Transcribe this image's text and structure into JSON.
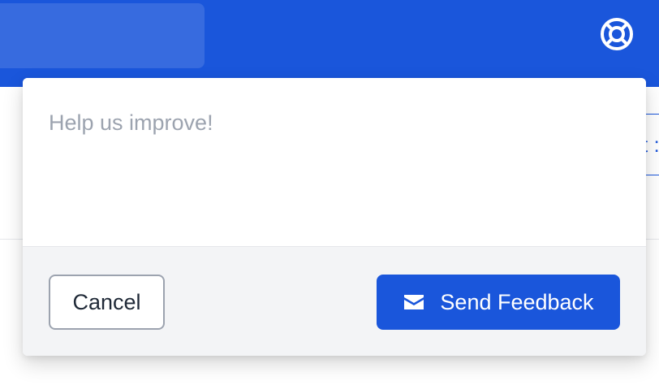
{
  "colors": {
    "brand": "#1a56db",
    "footer_bg": "#f3f4f6",
    "placeholder": "#9ca3af"
  },
  "topbar": {
    "help_icon": "lifebuoy-icon"
  },
  "background": {
    "partial_button_text": "t :"
  },
  "feedback": {
    "input_value": "",
    "placeholder": "Help us improve!",
    "cancel_label": "Cancel",
    "send_label": "Send Feedback",
    "send_icon": "envelope-icon"
  }
}
